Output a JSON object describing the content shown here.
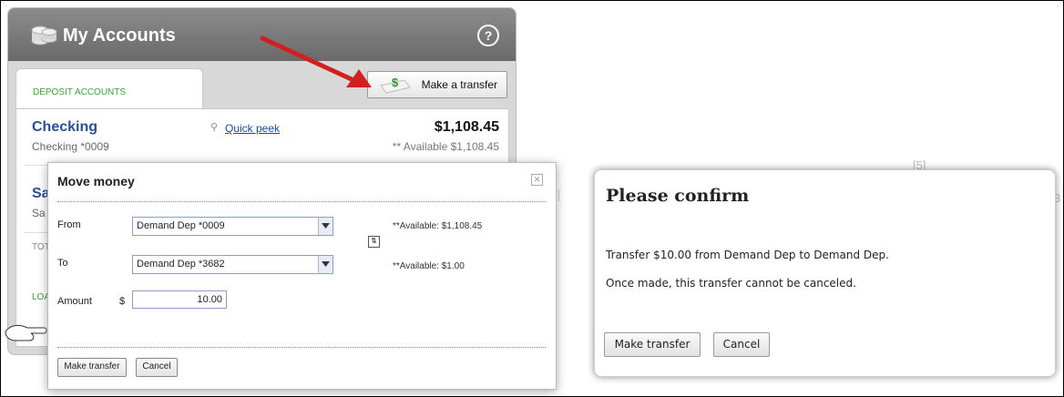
{
  "accounts": {
    "title": "My Accounts",
    "help": "?",
    "tab_label": "DEPOSIT ACCOUNTS",
    "transfer_button": "Make a transfer",
    "checking": {
      "name": "Checking",
      "sub": "Checking *0009",
      "quick_peek": "Quick peek",
      "balance": "$1,108.45",
      "available": "** Available $1,108.45"
    },
    "savings_name": "Sa",
    "savings_sub": "Sa",
    "totals": "TOT",
    "loans": "LOA"
  },
  "move_money": {
    "title": "Move money",
    "from_label": "From",
    "to_label": "To",
    "amount_label": "Amount",
    "currency": "$",
    "from_value": "Demand Dep *0009",
    "to_value": "Demand Dep *3682",
    "from_available": "**Available: $1,108.45",
    "to_available": "**Available: $1.00",
    "amount_value": "10.00",
    "submit": "Make transfer",
    "cancel": "Cancel"
  },
  "confirm": {
    "title": "Please confirm",
    "line1": "Transfer $10.00 from Demand Dep to Demand Dep.",
    "line2": "Once made, this transfer cannot be canceled.",
    "submit": "Make transfer",
    "cancel": "Cancel"
  },
  "colors": {
    "link": "#2a4f9a",
    "tab_green": "#3aa53a",
    "arrow_red": "#d02020"
  }
}
